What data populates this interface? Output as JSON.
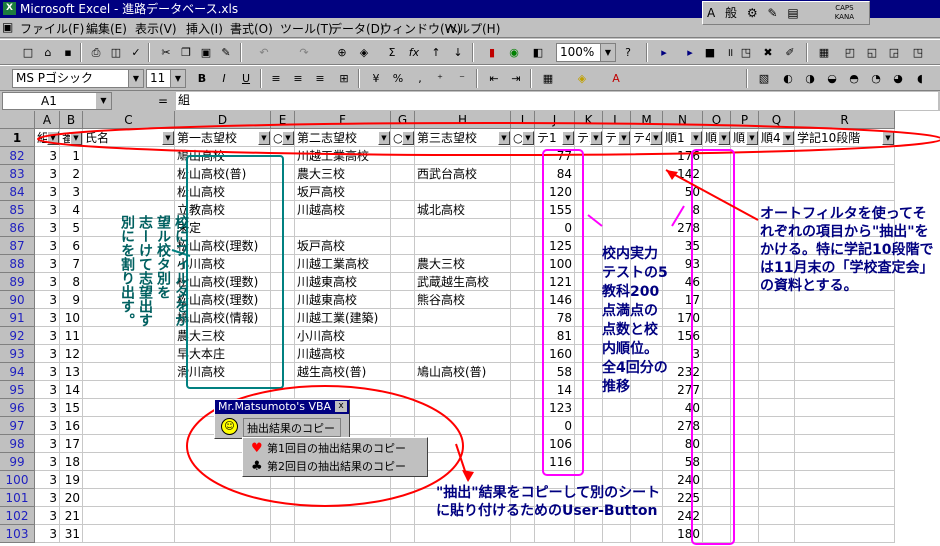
{
  "window": {
    "title": "Microsoft Excel - 進路データベース.xls",
    "app_icon_glyph": "X"
  },
  "ime": {
    "a": "A",
    "kanji": "般",
    "caps": "CAPS",
    "kana": "KANA"
  },
  "menu": [
    "ファイル(F)",
    "編集(E)",
    "表示(V)",
    "挿入(I)",
    "書式(O)",
    "ツール(T)",
    "データ(D)",
    "ウィンドウ(W)",
    "ヘルプ(H)"
  ],
  "toolbar1": {
    "zoom": "100%",
    "sigma": "Σ",
    "fx": "fx"
  },
  "toolbar2": {
    "font_name": "MS Pゴシック",
    "font_size": "11",
    "bold": "B",
    "italic": "I",
    "underline": "U",
    "percent": "%",
    "comma": ","
  },
  "formula": {
    "cell_ref": "A1",
    "equals": "=",
    "content": "組"
  },
  "columns": [
    "A",
    "B",
    "C",
    "D",
    "E",
    "F",
    "G",
    "H",
    "I",
    "J",
    "K",
    "L",
    "M",
    "N",
    "O",
    "P",
    "Q",
    "R"
  ],
  "header_row": {
    "row": "1",
    "cells": [
      "組",
      "番",
      "氏名",
      "第一志望校",
      "○",
      "第二志望校",
      "○",
      "第三志望校",
      "○",
      "テ1",
      "テ2",
      "テ3",
      "テ4",
      "順1",
      "順2",
      "順3",
      "順4",
      "学記10段階"
    ]
  },
  "rows": [
    {
      "row": "82",
      "a": "3",
      "b": "1",
      "d": "鳩山高校",
      "f": "川越工業高校",
      "h": "",
      "j": "77",
      "n": "176"
    },
    {
      "row": "83",
      "a": "3",
      "b": "2",
      "d": "松山高校(普)",
      "f": "農大三校",
      "h": "西武台高校",
      "j": "84",
      "n": "142"
    },
    {
      "row": "84",
      "a": "3",
      "b": "3",
      "d": "松山高校",
      "f": "坂戸高校",
      "h": "",
      "j": "120",
      "n": "50"
    },
    {
      "row": "85",
      "a": "3",
      "b": "4",
      "d": "立教高校",
      "f": "川越高校",
      "h": "城北高校",
      "j": "155",
      "n": "8"
    },
    {
      "row": "86",
      "a": "3",
      "b": "5",
      "d": "未定",
      "f": "",
      "h": "",
      "j": "0",
      "n": "278"
    },
    {
      "row": "87",
      "a": "3",
      "b": "6",
      "d": "松山高校(理数)",
      "f": "坂戸高校",
      "h": "",
      "j": "125",
      "n": "35"
    },
    {
      "row": "88",
      "a": "3",
      "b": "7",
      "d": "小川高校",
      "f": "川越工業高校",
      "h": "農大三校",
      "j": "100",
      "n": "93"
    },
    {
      "row": "89",
      "a": "3",
      "b": "8",
      "d": "松山高校(理数)",
      "f": "川越東高校",
      "h": "武蔵越生高校",
      "j": "121",
      "n": "46"
    },
    {
      "row": "90",
      "a": "3",
      "b": "9",
      "d": "松山高校(理数)",
      "f": "川越東高校",
      "h": "熊谷高校",
      "j": "146",
      "n": "17"
    },
    {
      "row": "91",
      "a": "3",
      "b": "10",
      "d": "鳩山高校(情報)",
      "f": "川越工業(建築)",
      "h": "",
      "j": "78",
      "n": "170"
    },
    {
      "row": "92",
      "a": "3",
      "b": "11",
      "d": "農大三校",
      "f": "小川高校",
      "h": "",
      "j": "81",
      "n": "156"
    },
    {
      "row": "93",
      "a": "3",
      "b": "12",
      "d": "早大本庄",
      "f": "川越高校",
      "h": "",
      "j": "160",
      "n": "3"
    },
    {
      "row": "94",
      "a": "3",
      "b": "13",
      "d": "滑川高校",
      "f": "越生高校(普)",
      "h": "鳩山高校(普)",
      "j": "58",
      "n": "232"
    },
    {
      "row": "95",
      "a": "3",
      "b": "14",
      "d": "",
      "f": "",
      "h": "",
      "j": "14",
      "n": "277"
    },
    {
      "row": "96",
      "a": "3",
      "b": "15",
      "d": "",
      "f": "",
      "h": "",
      "j": "123",
      "n": "40"
    },
    {
      "row": "97",
      "a": "3",
      "b": "16",
      "d": "",
      "f": "",
      "h": "",
      "j": "0",
      "n": "278"
    },
    {
      "row": "98",
      "a": "3",
      "b": "17",
      "d": "",
      "f": "",
      "h": "",
      "j": "106",
      "n": "80"
    },
    {
      "row": "99",
      "a": "3",
      "b": "18",
      "d": "",
      "f": "",
      "h": "",
      "j": "116",
      "n": "58"
    },
    {
      "row": "100",
      "a": "3",
      "b": "19",
      "d": "",
      "f": "",
      "h": "",
      "j": "",
      "n": "240"
    },
    {
      "row": "101",
      "a": "3",
      "b": "20",
      "d": "",
      "f": "",
      "h": "",
      "j": "",
      "n": "225"
    },
    {
      "row": "102",
      "a": "3",
      "b": "21",
      "d": "",
      "f": "",
      "h": "",
      "j": "",
      "n": "242"
    },
    {
      "row": "103",
      "a": "3",
      "b": "31",
      "d": "",
      "f": "",
      "h": "",
      "j": "",
      "n": "180"
    }
  ],
  "vba_toolbar": {
    "title": "Mr.Matsumoto's VBA",
    "close": "x",
    "button_label": "抽出結果のコピー",
    "menu_items": [
      {
        "glyph": "♥",
        "label": "第1回目の抽出結果のコピー",
        "color": "#ff0000"
      },
      {
        "glyph": "♣",
        "label": "第2回目の抽出結果のコピー",
        "color": "#000000"
      }
    ]
  },
  "annotations": {
    "right": "オートフィルタを使ってそれぞれの項目から\"抽出\"をかける。特に学記10段階では11月末の「学校査定会」の資料とする。",
    "middle": "校内実力テストの5教科200点満点の点数と校内順位。全4回分の推移",
    "bottom": "\"抽出\"結果をコピーして別のシートに貼り付けるためのUser-Button",
    "left_columns": [
      "校にフィルタをか",
      "望ル校タ別を",
      "志ーけて志望出す",
      "別にを割り出す。"
    ]
  },
  "colors": {
    "annotation_text": "#000080",
    "red_ellipse": "#ff0000",
    "magenta_box": "#ff00ff",
    "teal_box": "#008080",
    "title_bar": "#000080"
  }
}
